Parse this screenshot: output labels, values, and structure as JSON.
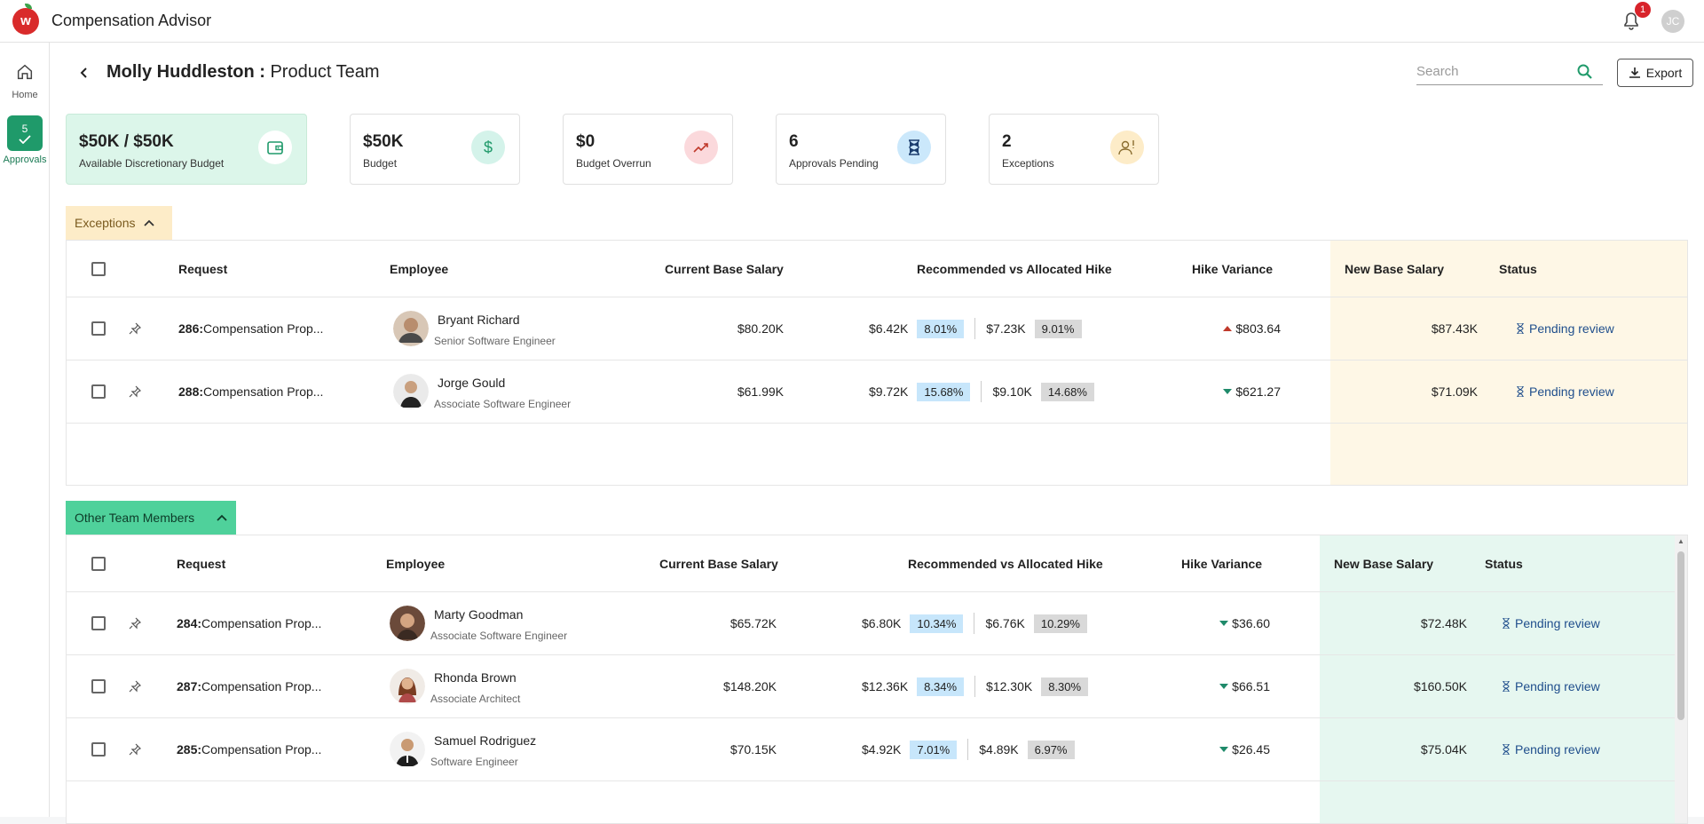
{
  "app": {
    "title": "Compensation Advisor",
    "notifications": "1",
    "user_initials": "JC"
  },
  "nav": {
    "home": "Home",
    "approvals_count": "5",
    "approvals": "Approvals"
  },
  "header": {
    "manager": "Molly Huddleston",
    "separator": " : ",
    "team": "Product Team",
    "search_placeholder": "Search",
    "export_label": "Export"
  },
  "cards": [
    {
      "value": "$50K / $50K",
      "label": "Available Discretionary Budget",
      "icon": "wallet-icon"
    },
    {
      "value": "$50K",
      "label": "Budget",
      "icon": "dollar-icon"
    },
    {
      "value": "$0",
      "label": "Budget Overrun",
      "icon": "trend-up-icon"
    },
    {
      "value": "6",
      "label": "Approvals Pending",
      "icon": "hourglass-icon"
    },
    {
      "value": "2",
      "label": "Exceptions",
      "icon": "person-alert-icon"
    }
  ],
  "columns": {
    "request": "Request",
    "employee": "Employee",
    "current": "Current Base Salary",
    "hike": "Recommended vs Allocated Hike",
    "variance": "Hike Variance",
    "newsalary": "New Base Salary",
    "status": "Status"
  },
  "exceptions": {
    "title": "Exceptions",
    "rows": [
      {
        "id": "286:",
        "request": " Compensation Prop...",
        "name": "Bryant Richard",
        "role": "Senior Software Engineer",
        "current": "$80.20K",
        "rec_amt": "$6.42K",
        "rec_pct": "8.01%",
        "alloc_amt": "$7.23K",
        "alloc_pct": "9.01%",
        "variance": "$803.64",
        "variance_dir": "up",
        "new_salary": "$87.43K",
        "status": "Pending review"
      },
      {
        "id": "288:",
        "request": " Compensation Prop...",
        "name": "Jorge Gould",
        "role": "Associate Software Engineer",
        "current": "$61.99K",
        "rec_amt": "$9.72K",
        "rec_pct": "15.68%",
        "alloc_amt": "$9.10K",
        "alloc_pct": "14.68%",
        "variance": "$621.27",
        "variance_dir": "down",
        "new_salary": "$71.09K",
        "status": "Pending review"
      }
    ]
  },
  "others": {
    "title": "Other Team Members",
    "rows": [
      {
        "id": "284:",
        "request": " Compensation Prop...",
        "name": "Marty Goodman",
        "role": "Associate Software Engineer",
        "current": "$65.72K",
        "rec_amt": "$6.80K",
        "rec_pct": "10.34%",
        "alloc_amt": "$6.76K",
        "alloc_pct": "10.29%",
        "variance": "$36.60",
        "variance_dir": "down",
        "new_salary": "$72.48K",
        "status": "Pending review"
      },
      {
        "id": "287:",
        "request": " Compensation Prop...",
        "name": "Rhonda Brown",
        "role": "Associate Architect",
        "current": "$148.20K",
        "rec_amt": "$12.36K",
        "rec_pct": "8.34%",
        "alloc_amt": "$12.30K",
        "alloc_pct": "8.30%",
        "variance": "$66.51",
        "variance_dir": "down",
        "new_salary": "$160.50K",
        "status": "Pending review"
      },
      {
        "id": "285:",
        "request": " Compensation Prop...",
        "name": "Samuel Rodriguez",
        "role": "Software Engineer",
        "current": "$70.15K",
        "rec_amt": "$4.92K",
        "rec_pct": "7.01%",
        "alloc_amt": "$4.89K",
        "alloc_pct": "6.97%",
        "variance": "$26.45",
        "variance_dir": "down",
        "new_salary": "$75.04K",
        "status": "Pending review"
      }
    ]
  },
  "colors": {
    "accent": "#1f9a6a",
    "exceptions_bg": "#fdecc8",
    "others_bg": "#4fd19b",
    "status": "#1f4e8c",
    "up": "#c0392b",
    "down": "#1f8a6a"
  }
}
